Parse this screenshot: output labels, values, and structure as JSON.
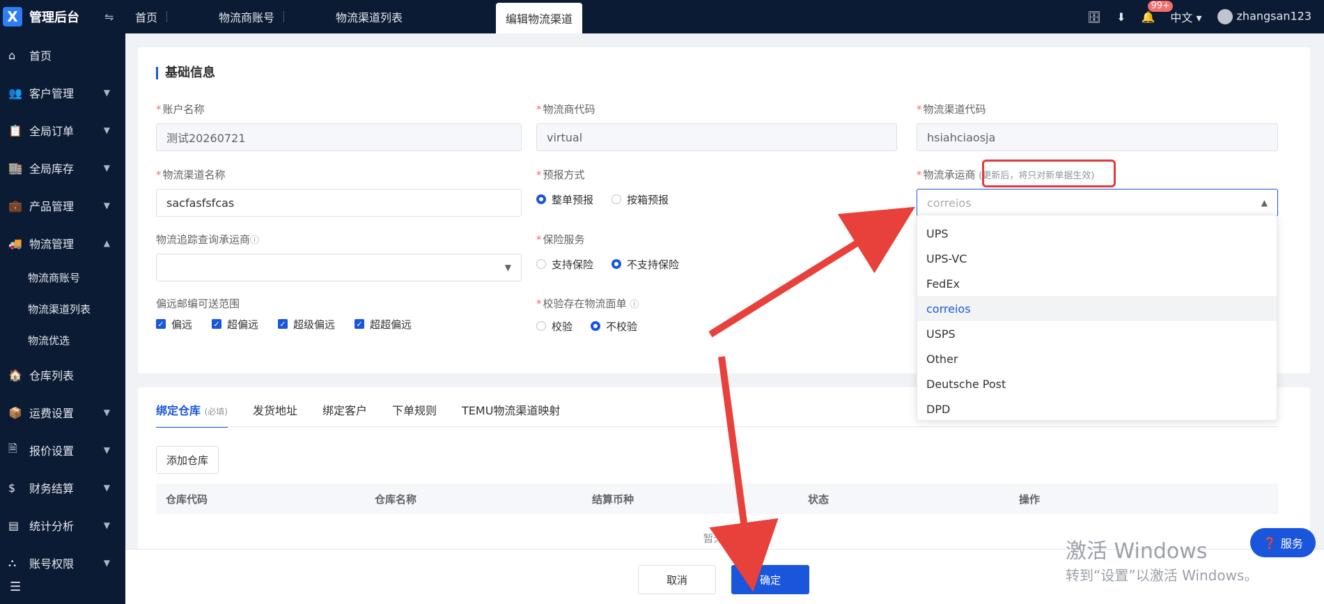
{
  "app": {
    "title": "管理后台",
    "logo_letter": "X"
  },
  "sidebar": {
    "items": [
      {
        "label": "首页",
        "icon": "home-icon",
        "glyph": "⌂",
        "expandable": false
      },
      {
        "label": "客户管理",
        "icon": "users-icon",
        "glyph": "👥",
        "expandable": true
      },
      {
        "label": "全局订单",
        "icon": "clipboard-icon",
        "glyph": "📋",
        "expandable": true
      },
      {
        "label": "全局库存",
        "icon": "warehouse-icon",
        "glyph": "🏬",
        "expandable": true
      },
      {
        "label": "产品管理",
        "icon": "briefcase-icon",
        "glyph": "💼",
        "expandable": true
      },
      {
        "label": "物流管理",
        "icon": "truck-icon",
        "glyph": "🚚",
        "expandable": true,
        "expanded": true,
        "children": [
          "物流商账号",
          "物流渠道列表",
          "物流优选"
        ]
      },
      {
        "label": "仓库列表",
        "icon": "warehouse-list-icon",
        "glyph": "🏠",
        "expandable": false
      },
      {
        "label": "运费设置",
        "icon": "shipping-settings-icon",
        "glyph": "📦",
        "expandable": true
      },
      {
        "label": "报价设置",
        "icon": "quote-icon",
        "glyph": "🗎",
        "expandable": true
      },
      {
        "label": "财务结算",
        "icon": "dollar-icon",
        "glyph": "$",
        "expandable": true
      },
      {
        "label": "统计分析",
        "icon": "chart-icon",
        "glyph": "▤",
        "expandable": true
      },
      {
        "label": "账号权限",
        "icon": "org-icon",
        "glyph": "⛬",
        "expandable": true
      }
    ]
  },
  "topbar": {
    "tabs": [
      {
        "label": "首页",
        "active": false
      },
      {
        "label": "物流商账号",
        "active": false
      },
      {
        "label": "物流渠道列表",
        "active": false
      },
      {
        "label": "编辑物流渠道",
        "active": true
      }
    ],
    "notification_count": "99+",
    "language": "中文",
    "username": "zhangsan123"
  },
  "form": {
    "section_title": "基础信息",
    "account_name": {
      "label": "账户名称",
      "value": "测试20260721"
    },
    "logistics_provider_code": {
      "label": "物流商代码",
      "value": "virtual"
    },
    "channel_code": {
      "label": "物流渠道代码",
      "value": "hsiahciaosja"
    },
    "channel_name": {
      "label": "物流渠道名称",
      "value": "sacfasfsfcas"
    },
    "forecast_method": {
      "label": "预报方式",
      "options": [
        "整单预报",
        "按箱预报"
      ],
      "selected": 0
    },
    "carrier": {
      "label": "物流承运商",
      "hint": "(更新后，将只对新单据生效)",
      "placeholder": "correios"
    },
    "tracking_carrier": {
      "label": "物流追踪查询承运商",
      "value": ""
    },
    "insurance": {
      "label": "保险服务",
      "options": [
        "支持保险",
        "不支持保险"
      ],
      "selected": 1
    },
    "remote_range": {
      "label": "偏远邮编可送范围",
      "options": [
        "偏远",
        "超偏远",
        "超级偏远",
        "超超偏远"
      ]
    },
    "verify_label": {
      "label": "校验存在物流面单",
      "options": [
        "校验",
        "不校验"
      ],
      "selected": 1
    }
  },
  "dropdown": {
    "options": [
      "UPS",
      "UPS-VC",
      "FedEx",
      "correios",
      "USPS",
      "Other",
      "Deutsche Post",
      "DPD"
    ],
    "selected": "correios"
  },
  "bottom_tabs": {
    "tabs": [
      "绑定仓库",
      "发货地址",
      "绑定客户",
      "下单规则",
      "TEMU物流渠道映射"
    ],
    "required_tag": "(必填)",
    "add_button": "添加仓库",
    "columns": [
      "仓库代码",
      "仓库名称",
      "结算币种",
      "状态",
      "操作"
    ],
    "empty_text": "暂无数据"
  },
  "actions": {
    "cancel": "取消",
    "confirm": "确定"
  },
  "overlay": {
    "activate_line1": "激活 Windows",
    "activate_line2": "转到“设置”以激活 Windows。",
    "service": "服务"
  },
  "colors": {
    "primary": "#1a56db",
    "sidebar": "#0b1b33",
    "annotation": "#e23a3a"
  }
}
